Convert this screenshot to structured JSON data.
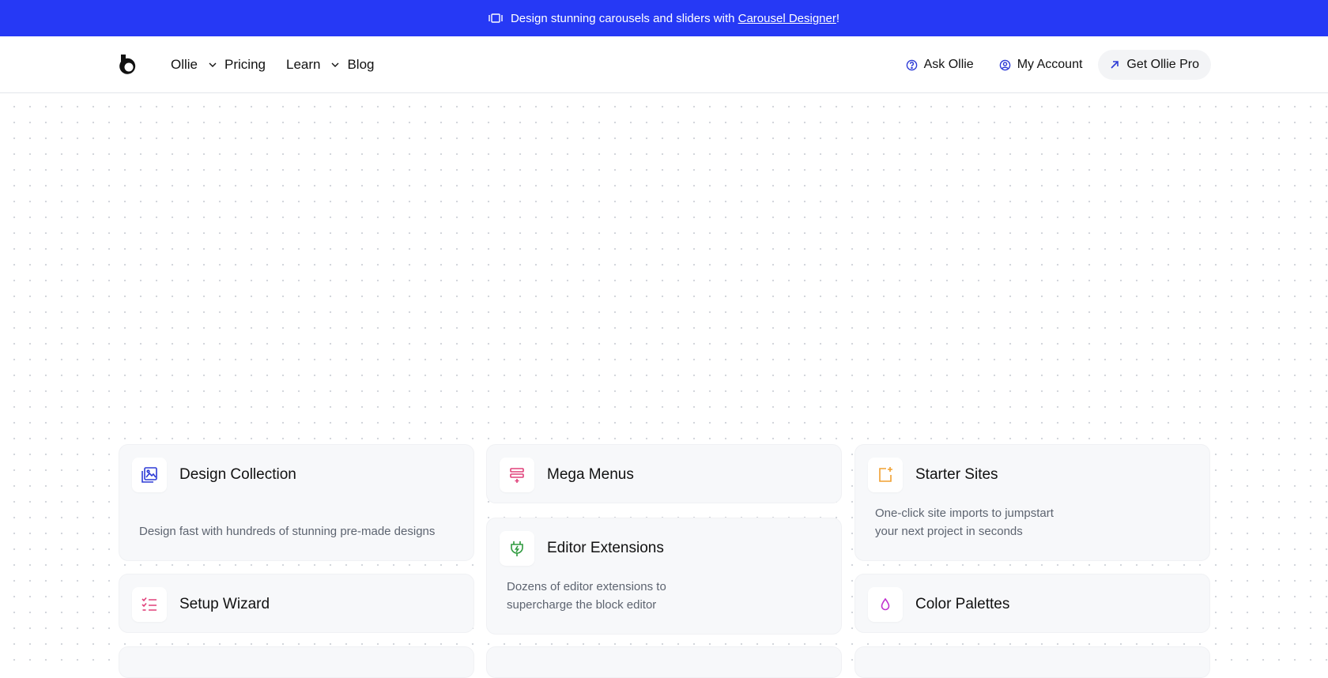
{
  "announcement": {
    "prefix": "Design stunning carousels and sliders with ",
    "link": "Carousel Designer",
    "suffix": "!",
    "icon": "carousel-icon"
  },
  "nav": {
    "items": [
      {
        "label": "Ollie",
        "dropdown": true
      },
      {
        "label": "Pricing",
        "dropdown": false
      },
      {
        "label": "Learn",
        "dropdown": true
      },
      {
        "label": "Blog",
        "dropdown": false
      }
    ],
    "ask": "Ask Ollie",
    "account": "My Account",
    "pro": "Get Ollie Pro"
  },
  "cards": {
    "design_collection": {
      "title": "Design Collection",
      "desc": "Design fast with hundreds of stunning pre-made designs",
      "icon": "image-gallery-icon",
      "color": "#2d3bd6"
    },
    "mega_menus": {
      "title": "Mega Menus",
      "icon": "mega-menu-icon",
      "color": "#e0407a"
    },
    "starter_sites": {
      "title": "Starter Sites",
      "desc_line1": "One-click site imports to jumpstart",
      "desc_line2": "your next project in seconds",
      "icon": "add-frame-icon",
      "color": "#f0a030"
    },
    "editor_extensions": {
      "title": "Editor Extensions",
      "desc_line1": "Dozens of editor extensions to",
      "desc_line2": "supercharge the block editor",
      "icon": "plug-icon",
      "color": "#2e9a3e"
    },
    "setup_wizard": {
      "title": "Setup Wizard",
      "icon": "checklist-icon",
      "color": "#e0407a"
    },
    "color_palettes": {
      "title": "Color Palettes",
      "icon": "droplet-icon",
      "color": "#c030d0"
    }
  },
  "colors": {
    "banner": "#2639f5",
    "card_bg": "#f7f8fa"
  }
}
